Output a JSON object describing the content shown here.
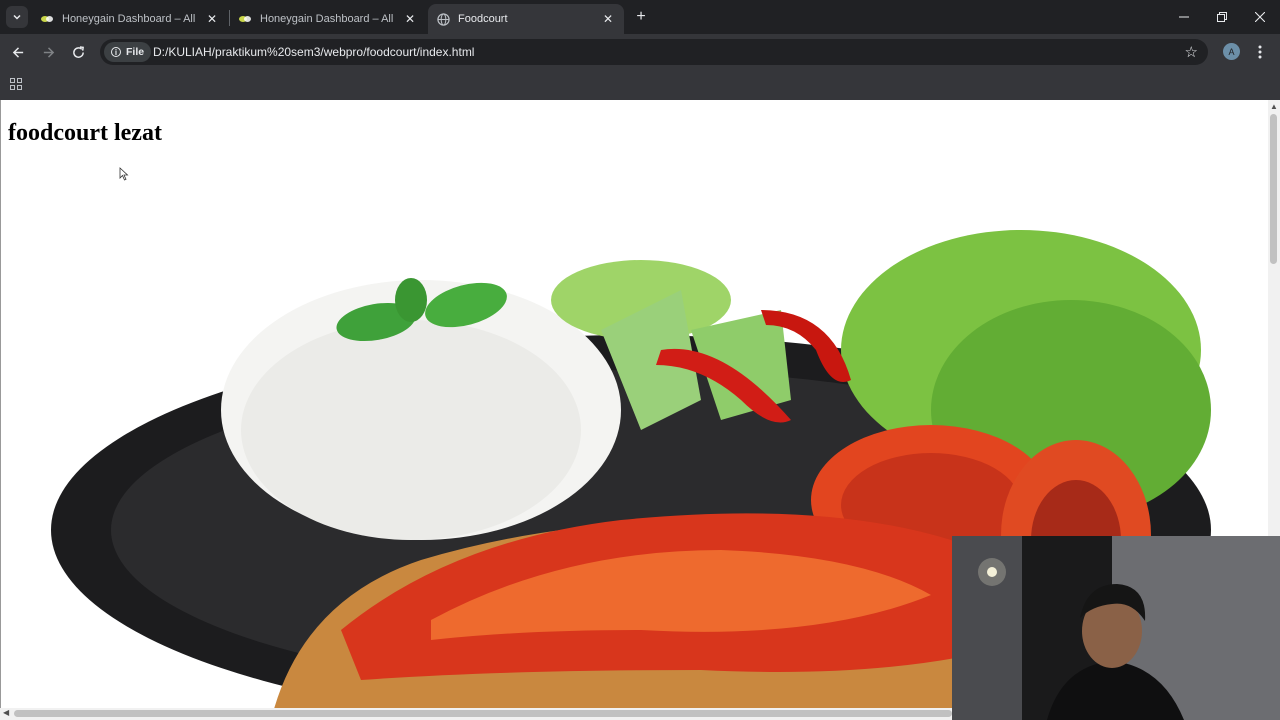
{
  "browser": {
    "tabs": [
      {
        "title": "Honeygain Dashboard – All You",
        "icon": "honeygain-icon",
        "active": false
      },
      {
        "title": "Honeygain Dashboard – All You",
        "icon": "honeygain-icon",
        "active": false
      },
      {
        "title": "Foodcourt",
        "icon": "globe-icon",
        "active": true
      }
    ],
    "close_glyph": "✕",
    "new_tab_glyph": "+",
    "omnibox": {
      "chip_label": "File",
      "url": "D:/KULIAH/praktikum%20sem3/webpro/foodcourt/index.html"
    },
    "profile_initial": "A",
    "accent": "#35363a"
  },
  "page": {
    "heading": "foodcourt lezat",
    "image_subject": "ayam geprek with rice, lettuce, tomato, cucumber and chili on a black plate"
  },
  "overlay": {
    "type": "webcam"
  }
}
